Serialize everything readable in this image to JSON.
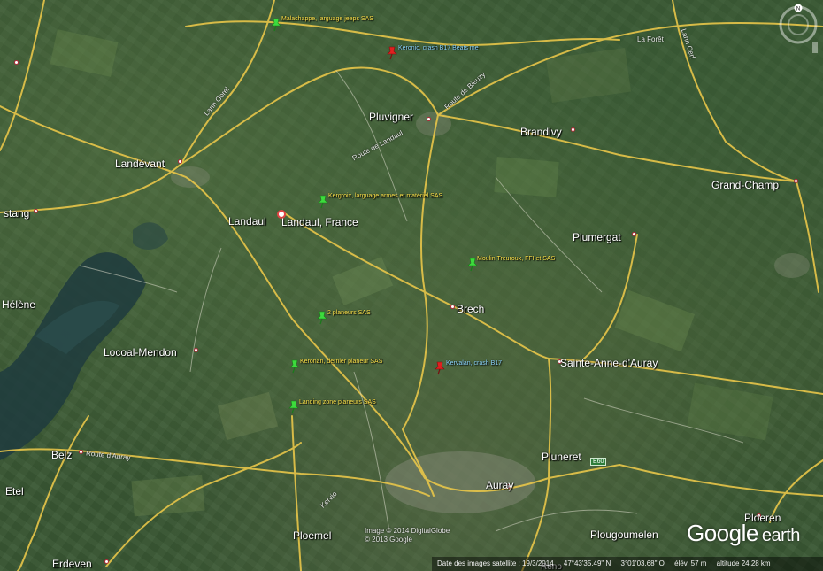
{
  "map": {
    "places": [
      {
        "id": "landevant",
        "label": "Landévant"
      },
      {
        "id": "landaul",
        "label": "Landaul"
      },
      {
        "id": "search-result",
        "label": "Landaul, France"
      },
      {
        "id": "pluvigner",
        "label": "Pluvigner"
      },
      {
        "id": "brandivy",
        "label": "Brandivy"
      },
      {
        "id": "grand-champ",
        "label": "Grand-Champ"
      },
      {
        "id": "plumergat",
        "label": "Plumergat"
      },
      {
        "id": "brech",
        "label": "Brech"
      },
      {
        "id": "sainte-anne",
        "label": "Sainte-Anne-d'Auray"
      },
      {
        "id": "locoal",
        "label": "Locoal-Mendon"
      },
      {
        "id": "pluneret",
        "label": "Pluneret"
      },
      {
        "id": "auray",
        "label": "Auray"
      },
      {
        "id": "belz",
        "label": "Belz"
      },
      {
        "id": "etel",
        "label": "Etel"
      },
      {
        "id": "ploemel",
        "label": "Ploemel"
      },
      {
        "id": "erdeven",
        "label": "Erdeven"
      },
      {
        "id": "plougoumelen",
        "label": "Plougoumelen"
      },
      {
        "id": "ploeren",
        "label": "Ploeren"
      },
      {
        "id": "helene",
        "label": "Hélène"
      },
      {
        "id": "nostang",
        "label": "stang"
      },
      {
        "id": "reno",
        "label": "Reno"
      }
    ],
    "roads": [
      {
        "id": "route-de-bieuzy",
        "label": "Route de Bieuzy"
      },
      {
        "id": "route-de-landaul",
        "label": "Route de Landaul"
      },
      {
        "id": "route-d-auray",
        "label": "Route d'Auray"
      },
      {
        "id": "la-foret",
        "label": "La Forêt"
      },
      {
        "id": "kervio",
        "label": "Kervio"
      },
      {
        "id": "lann-cerf",
        "label": "Lann Cerf"
      },
      {
        "id": "landevant-road",
        "label": "Lann Gorel"
      }
    ],
    "pins": [
      {
        "id": "malachappe",
        "label": "Malachappe, larguage jeeps SAS",
        "color": "green"
      },
      {
        "id": "keronic",
        "label": "Keronic, crash B17 Beats me",
        "color": "red"
      },
      {
        "id": "kergroix",
        "label": "Kergroix, larguage armes et matériel SAS",
        "color": "green"
      },
      {
        "id": "moulin",
        "label": "Moulin Treuroux, FFI et SAS",
        "color": "green"
      },
      {
        "id": "planeurs",
        "label": "2 planeurs SAS",
        "color": "green"
      },
      {
        "id": "keronan",
        "label": "Keronan, dernier planeur SAS",
        "color": "green"
      },
      {
        "id": "kervalan",
        "label": "Kervalan, crash B17",
        "color": "red"
      },
      {
        "id": "landing",
        "label": "Landing zone planeurs SAS",
        "color": "green"
      }
    ],
    "shield": "E60",
    "copyright": [
      "Image © 2014 DigitalGlobe",
      "© 2013 Google"
    ],
    "logo": {
      "google": "Google",
      "earth": "earth"
    }
  },
  "status": {
    "imagery_date": "Date des images satellite : 19/3/2014",
    "latitude": "47°43'35.49\" N",
    "longitude": "3°01'03.68\" O",
    "elevation": "élév.    57 m",
    "altitude": "altitude  24.28 km"
  },
  "compass": {
    "north_label": "N"
  },
  "colors": {
    "road": "#e8c64a",
    "green_pin": "#3ddc3d",
    "red_pin": "#e02020",
    "pin_label": "#ffe64d",
    "crash_label": "#8fd9ff"
  }
}
